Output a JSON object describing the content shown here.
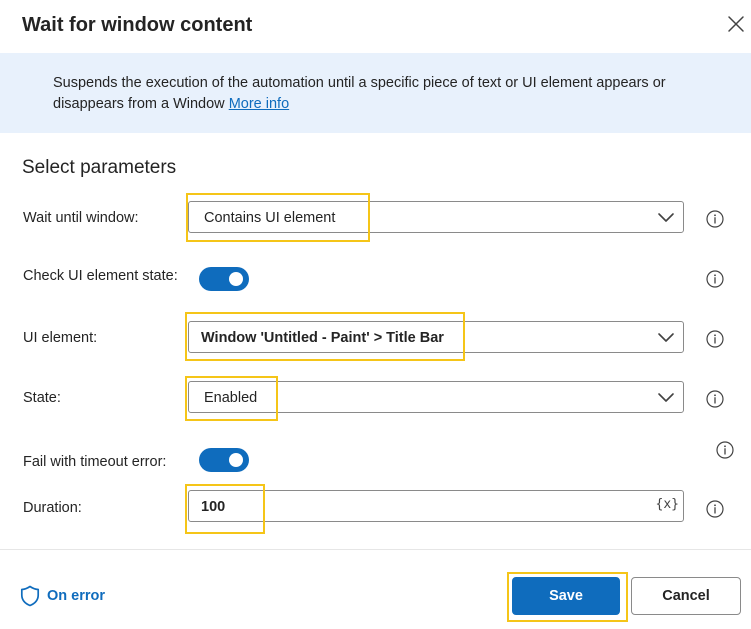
{
  "dialog": {
    "title": "Wait for window content",
    "close_icon": "close-icon"
  },
  "banner": {
    "description": "Suspends the execution of the automation until a specific piece of text or UI element appears or disappears from a Window",
    "more_info_label": "More info"
  },
  "parameters": {
    "section_title": "Select parameters",
    "wait_until_window": {
      "label": "Wait until window:",
      "value": "Contains UI element"
    },
    "check_ui_element_state": {
      "label": "Check UI element state:",
      "enabled": true
    },
    "ui_element": {
      "label": "UI element:",
      "value": "Window 'Untitled - Paint' > Title Bar"
    },
    "state": {
      "label": "State:",
      "value": "Enabled"
    },
    "fail_with_timeout_error": {
      "label": "Fail with timeout error:",
      "enabled": true
    },
    "duration": {
      "label": "Duration:",
      "value": "100",
      "variable_button": "{x}"
    }
  },
  "footer": {
    "on_error_label": "On error",
    "save_label": "Save",
    "cancel_label": "Cancel"
  },
  "colors": {
    "accent": "#0f6cbd",
    "banner_bg": "#e8f1fc",
    "highlight": "#f5c518"
  }
}
